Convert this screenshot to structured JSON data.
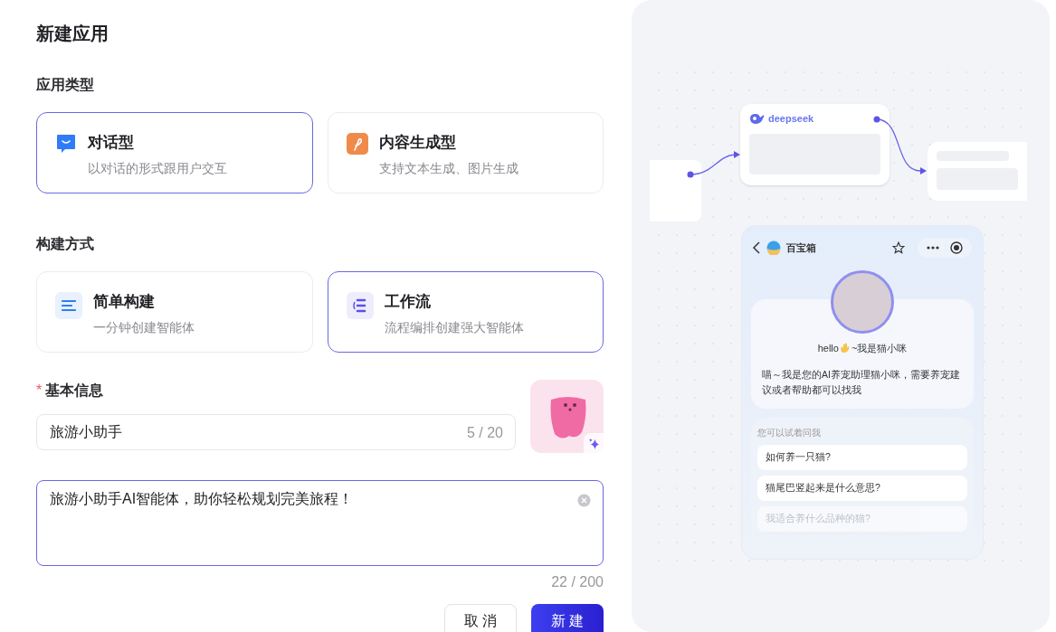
{
  "title": "新建应用",
  "app_type": {
    "label": "应用类型",
    "options": [
      {
        "kind": "chat",
        "title": "对话型",
        "description": "以对话的形式跟用户交互",
        "selected": true
      },
      {
        "kind": "content",
        "title": "内容生成型",
        "description": "支持文本生成、图片生成",
        "selected": false
      }
    ]
  },
  "build_method": {
    "label": "构建方式",
    "options": [
      {
        "kind": "simple",
        "title": "简单构建",
        "description": "一分钟创建智能体",
        "selected": false
      },
      {
        "kind": "workflow",
        "title": "工作流",
        "description": "流程编排创建强大智能体",
        "selected": true
      }
    ]
  },
  "basic_info": {
    "label": "基本信息",
    "required": true,
    "required_mark": "*",
    "name": {
      "value": "旅游小助手",
      "counter": "5 / 20"
    },
    "description": {
      "value": "旅游小助手AI智能体，助你轻松规划完美旅程！",
      "counter": "22 / 200"
    }
  },
  "buttons": [
    {
      "kind": "secondary",
      "label": "取 消"
    },
    {
      "kind": "primary",
      "label": "新 建"
    }
  ],
  "preview": {
    "node_brand": "deepseek",
    "phone": {
      "title": "百宝箱",
      "greeting_start": "hello",
      "greeting_end": "~我是猫小咪",
      "intro": "喵～我是您的AI养宠助理猫小咪，需要养宠建议或者帮助都可以找我",
      "suggestions_label": "您可以试着问我",
      "suggestions": [
        {
          "text": "如何养一只猫?",
          "faded": false
        },
        {
          "text": "猫尾巴竖起来是什么意思?",
          "faded": false
        },
        {
          "text": "我适合养什么品种的猫?",
          "faded": true
        }
      ]
    }
  }
}
